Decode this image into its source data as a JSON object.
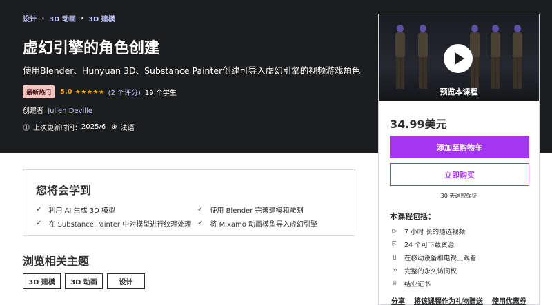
{
  "breadcrumb": [
    "设计",
    "3D 动画",
    "3D 建模"
  ],
  "course": {
    "title": "虚幻引擎的角色创建",
    "subtitle": "使用Blender、Hunyuan 3D、Substance Painter创建可导入虚幻引擎的视频游戏角色",
    "badge": "最新热门",
    "rating": "5.0",
    "rating_count": "(2 个评分)",
    "students": "19 个学生",
    "creator_label": "创建者",
    "creator": "Julien Deville",
    "updated_label": "上次更新时间：",
    "updated": "2025/6",
    "language": "法语"
  },
  "learn": {
    "title": "您将会学到",
    "items": [
      "利用 AI 生成 3D 模型",
      "使用 Blender 完善建模和雕刻",
      "在 Substance Painter 中对模型进行纹理处理",
      "将 Mixamo 动画模型导入虚幻引擎"
    ]
  },
  "topics": {
    "title": "浏览相关主题",
    "items": [
      "3D 建模",
      "3D 动画",
      "设计"
    ]
  },
  "card": {
    "preview_label": "预览本课程",
    "price": "34.99美元",
    "add_to_cart": "添加至购物车",
    "buy_now": "立即购买",
    "guarantee": "30 天退款保证",
    "includes_title": "本课程包括：",
    "includes": [
      {
        "icon": "video-icon",
        "text": "7 小时 长的随选视频"
      },
      {
        "icon": "download-file-icon",
        "text": "24 个可下载资源"
      },
      {
        "icon": "mobile-icon",
        "text": "在移动设备和电视上观看"
      },
      {
        "icon": "infinity-icon",
        "text": "完整的永久访问权"
      },
      {
        "icon": "trophy-icon",
        "text": "结业证书"
      }
    ],
    "share": "分享",
    "gift": "将该课程作为礼物赠送",
    "coupon": "使用优惠券"
  },
  "colors": {
    "accent": "#a435f0",
    "hero_bg": "#1c1d1f",
    "link_light": "#c0c4fc",
    "star": "#f69c08",
    "badge_bg": "#f4c4c0"
  }
}
